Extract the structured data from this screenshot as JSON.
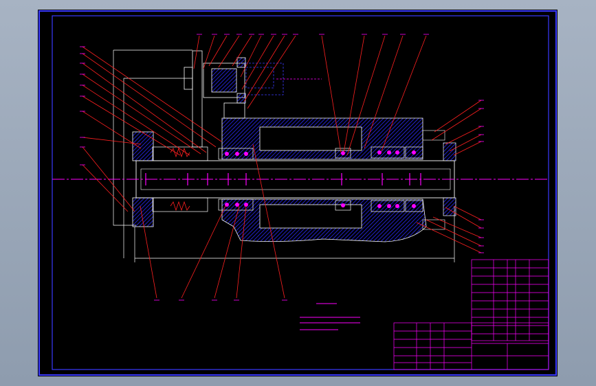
{
  "drawing": {
    "type": "cad-assembly-drawing",
    "colors": {
      "background": "#000000",
      "frame": "#3a3aff",
      "outline": "#ffffff",
      "leaders": "#ff2020",
      "annotation": "#ff00ff",
      "centerline": "#ff00ff",
      "hatch": "#2a2aff"
    }
  }
}
